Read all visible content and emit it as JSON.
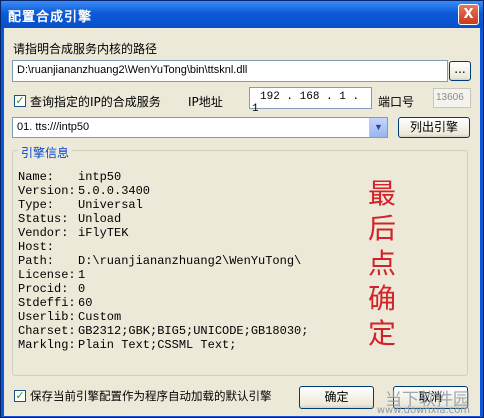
{
  "window": {
    "title": "配置合成引擎",
    "close_glyph": "X"
  },
  "path": {
    "label": "请指明合成服务内核的路径",
    "value": "D:\\ruanjiananzhuang2\\WenYuTong\\bin\\ttsknl.dll",
    "browse_label": "..."
  },
  "query": {
    "checkbox_label": "查询指定的IP的合成服务",
    "checked": true,
    "ip_label": "IP地址",
    "ip": [
      "192",
      "168",
      "1",
      "1"
    ],
    "port_label": "端口号",
    "port_value": "13606"
  },
  "engine_select": {
    "selected": "01. tts:///intp50",
    "list_button": "列出引擎"
  },
  "engine_info": {
    "group_label": "引擎信息",
    "rows": [
      {
        "key": "Name:",
        "value": "intp50"
      },
      {
        "key": "Version:",
        "value": "5.0.0.3400"
      },
      {
        "key": "Type:",
        "value": "Universal"
      },
      {
        "key": "Status:",
        "value": "Unload"
      },
      {
        "key": "Vendor:",
        "value": "iFlyTEK"
      },
      {
        "key": "Host:",
        "value": ""
      },
      {
        "key": "Path:",
        "value": "D:\\ruanjiananzhuang2\\WenYuTong\\"
      },
      {
        "key": "License:",
        "value": "1"
      },
      {
        "key": "Procid:",
        "value": "0"
      },
      {
        "key": "Stdeffi:",
        "value": "60"
      },
      {
        "key": "Userlib:",
        "value": "Custom"
      },
      {
        "key": "Charset:",
        "value": "GB2312;GBK;BIG5;UNICODE;GB18030;"
      },
      {
        "key": "Marklng:",
        "value": "Plain Text;CSSML Text;"
      }
    ]
  },
  "annotation": {
    "text": [
      "最",
      "后",
      "点",
      "确",
      "定"
    ]
  },
  "footer": {
    "save_default_label": "保存当前引擎配置作为程序自动加载的默认引擎",
    "save_default_checked": true,
    "ok_label": "确定",
    "cancel_label": "取消"
  },
  "watermark": {
    "text": "当下软件园",
    "sub": "www.downxia.com"
  },
  "icons": {
    "checkmark": "check-icon",
    "dropdown": "chevron-down-icon",
    "close": "close-icon"
  }
}
